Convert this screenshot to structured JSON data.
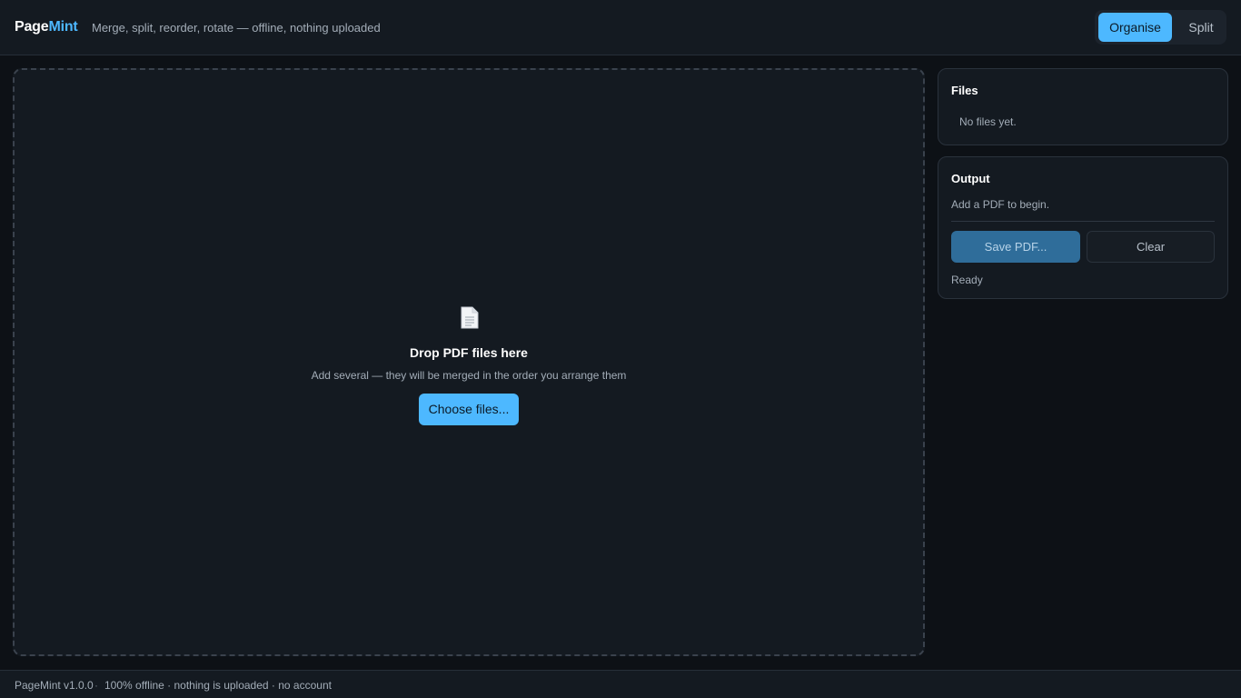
{
  "header": {
    "brand_part1": "Page",
    "brand_part2": "Mint",
    "tagline": "Merge, split, reorder, rotate — offline, nothing uploaded",
    "tabs": [
      {
        "label": "Organise",
        "active": true
      },
      {
        "label": "Split",
        "active": false
      }
    ]
  },
  "dropzone": {
    "icon": "document-icon",
    "title": "Drop PDF files here",
    "subtitle": "Add several — they will be merged in the order you arrange them",
    "button_label": "Choose files..."
  },
  "files_panel": {
    "title": "Files",
    "empty_text": "No files yet."
  },
  "output_panel": {
    "title": "Output",
    "hint": "Add a PDF to begin.",
    "save_label": "Save PDF...",
    "clear_label": "Clear",
    "status": "Ready"
  },
  "footer": {
    "version": "PageMint v1.0.0",
    "separator": "·",
    "info": "100% offline · nothing is uploaded · no account"
  },
  "colors": {
    "accent": "#4db8ff",
    "background": "#0d1116",
    "panel": "#141a21"
  }
}
